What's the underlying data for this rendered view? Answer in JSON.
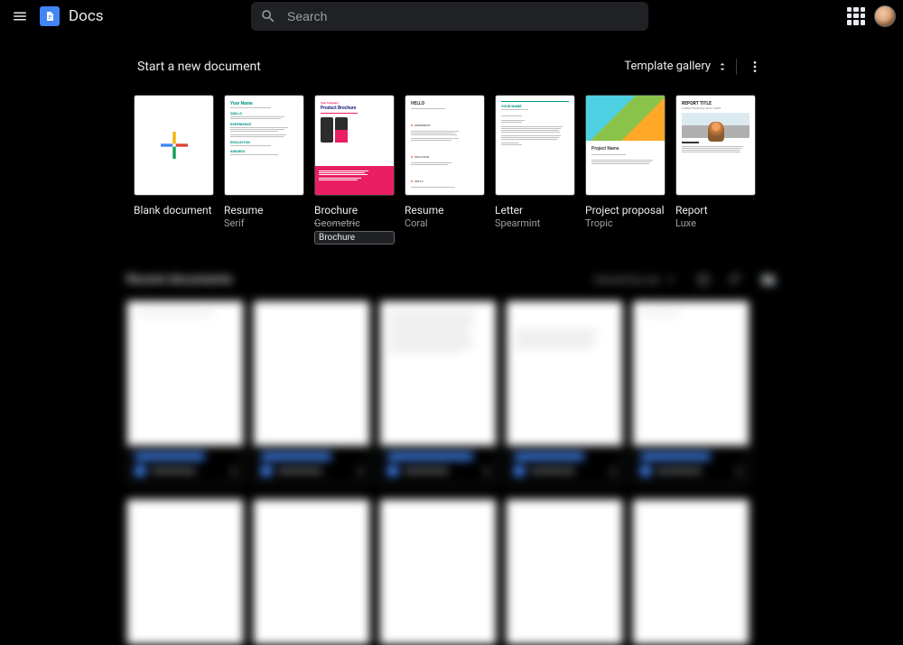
{
  "header": {
    "app_title": "Docs",
    "search_placeholder": "Search"
  },
  "templates_section": {
    "title": "Start a new document",
    "gallery_label": "Template gallery"
  },
  "templates": [
    {
      "name": "Blank document",
      "subtitle": ""
    },
    {
      "name": "Resume",
      "subtitle": "Serif"
    },
    {
      "name": "Brochure",
      "subtitle": "Geometric",
      "tooltip": "Brochure"
    },
    {
      "name": "Resume",
      "subtitle": "Coral"
    },
    {
      "name": "Letter",
      "subtitle": "Spearmint"
    },
    {
      "name": "Project proposal",
      "subtitle": "Tropic"
    },
    {
      "name": "Report",
      "subtitle": "Luxe"
    }
  ],
  "docs": {
    "section_title": "Recent documents",
    "owned_label": "Owned by me"
  },
  "preview": {
    "resume_name": "Your Name",
    "brochure_top": "Your Company",
    "brochure_title": "Product Brochure",
    "project_name": "Project Name",
    "report_title": "REPORT TITLE",
    "report_sub": "LOREM IPSUM DOLOR SIT AMET"
  }
}
